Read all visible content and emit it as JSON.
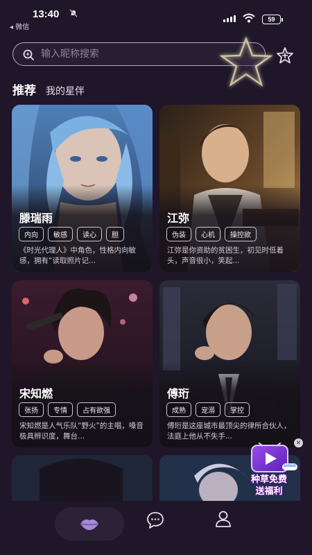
{
  "status_bar": {
    "time": "13:40",
    "back_app": "◂ 微信",
    "battery": "59"
  },
  "search": {
    "placeholder": "输入昵称搜索"
  },
  "tabs": {
    "active": "推荐",
    "other": "我的星伴"
  },
  "cards": [
    {
      "name": "滕瑞雨",
      "tags": [
        "内向",
        "敏感",
        "读心",
        "胆"
      ],
      "desc": "《时光代理人》中角色，性格内向敏感，拥有“读取照片记..."
    },
    {
      "name": "江弥",
      "tags": [
        "伪装",
        "心机",
        "操控欲"
      ],
      "desc": "江弥是你资助的贫困生，初见时低着头，声音很小，笑起..."
    },
    {
      "name": "宋知燃",
      "tags": [
        "张扬",
        "专情",
        "占有欲强"
      ],
      "desc": "宋知燃是人气乐队“野火”的主唱，嗓音极具辨识度，舞台..."
    },
    {
      "name": "傅珩",
      "tags": [
        "成熟",
        "宠溺",
        "掌控"
      ],
      "desc": "傅珩是这座城市最顶尖的律所合伙人，法庭上他从不失手..."
    }
  ],
  "promo": {
    "line1": "种草免费",
    "line2": "送福利",
    "badge": "bilibili"
  },
  "colors": {
    "background": "#1f1629",
    "nav_active_pill": "#2c2238",
    "accent_purple": "#a58ad8"
  },
  "icons": {
    "search": "sparkle-search-icon",
    "favorite": "star-icon",
    "home": "lips-icon",
    "chat": "chat-bubble-icon",
    "profile": "person-icon"
  }
}
